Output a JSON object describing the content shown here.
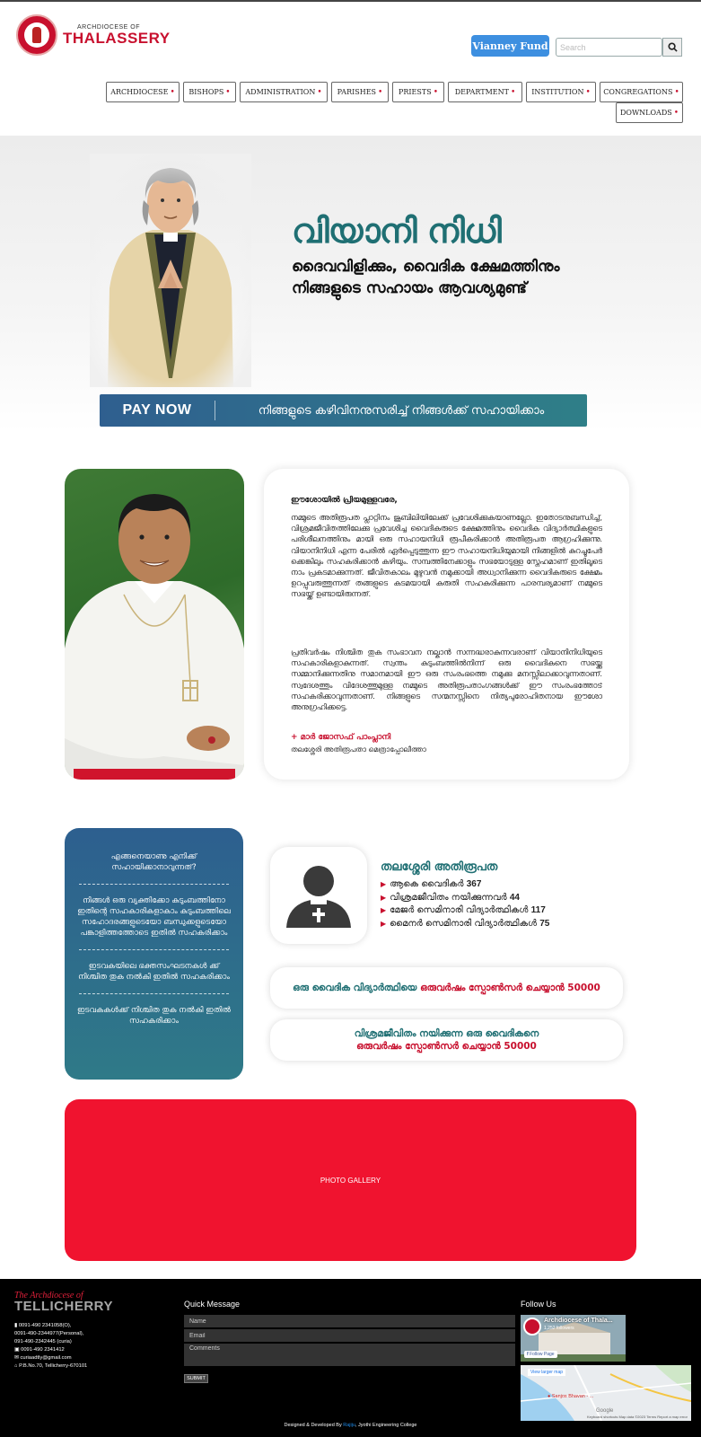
{
  "header": {
    "logo_small": "ARCHDIOCESE OF",
    "logo_big": "THALASSERY",
    "vianney_label": "Vianney Fund",
    "search_placeholder": "Search",
    "nav": [
      "ARCHDIOCESE",
      "BISHOPS",
      "ADMINISTRATION",
      "PARISHES",
      "PRIESTS",
      "DEPARTMENT",
      "INSTITUTION",
      "CONGREGATIONS",
      "DOWNLOADS"
    ]
  },
  "banner": {
    "title": "വിയാനി നിധി",
    "subtitle_line1": "ദൈവവിളിക്കും, വൈദിക ക്ഷേമത്തിനും",
    "subtitle_line2": "നിങ്ങളുടെ സഹായം ആവശ്യമുണ്ട്",
    "pay_now": "PAY NOW",
    "pay_text": "നിങ്ങളുടെ കഴിവിനനുസരിച്ച് നിങ്ങൾക്ക് സഹായിക്കാം"
  },
  "letter": {
    "salutation": "ഈശോയിൽ പ്രിയമുള്ളവരേ,",
    "para1": "നമ്മുടെ അതിരൂപത പ്ലാറ്റിനം ജൂബിലിയിലേക്ക് പ്രവേശിക്കുകയാണല്ലോ. ഇതോടനുബന്ധിച്ച്, വിശ്രമജീവിതത്തിലേക്കു പ്രവേശിച്ച വൈദികരുടെ ക്ഷേമത്തിനും വൈദിക വിദ്യാർത്ഥികളുടെ പരിശീലനത്തിനും മായി ഒരു സഹായനിധി രൂപീകരിക്കാൻ അതിരൂപത ആഗ്രഹിക്കുന്നു. വിയാനിനിധി എന്ന പേരിൽ ഏർപ്പെടുത്തുന്ന ഈ സഹായനിധിയുമായി നിങ്ങളിൽ കുറച്ചുപേർ ക്കെങ്കിലും സഹകരിക്കാൻ കഴിയും. സമ്പത്തിനേക്കാളും സഭയോടുള്ള സ്നേഹമാണ് ഇതിലൂടെ നാം പ്രകടമാക്കുന്നത്. ജീവിതകാലം മുഴുവൻ നമുക്കായി അധ്വാനിക്കുന്ന വൈദികരുടെ ക്ഷേമം ഉറപ്പുവരുത്തുന്നത് തങ്ങളുടെ കടമയായി കരുതി സഹകരിക്കുന്ന പാരമ്പര്യമാണ് നമ്മുടെ സഭയ്ക്ക് ഉണ്ടായിരുന്നത്.",
    "para2": "പ്രതിവർഷം നിശ്ചിത തുക സംഭാവന നല്കാൻ സന്നദ്ധരാകുന്നവരാണ് വിയാനിനിധിയുടെ സഹകാരികളാകുന്നത്. സ്വന്തം കുടുംബത്തിൽനിന്ന് ഒരു വൈദികനെ സഭയ്ക്കു സമ്മാനിക്കുന്നതിനു സമാനമായി ഈ ഒരു സംരംഭത്തെ നമുക്കു മനസ്സിലാക്കാവുന്നതാണ്. സ്വദേശത്തും വിദേശത്തുമുള്ള നമ്മുടെ അതിരൂപതാംഗങ്ങൾക്ക് ഈ സംരംഭത്തോട് സഹകരിക്കാവുന്നതാണ്. നിങ്ങളുടെ സന്മനസ്സിനെ നിത്യപുരോഹിതനായ ഈശോ അനുഗ്രഹിക്കട്ടെ.",
    "signature": "+ മാർ ജോസഫ് പാംപ്ലാനി",
    "role": "തലശ്ശേരി അതിരൂപതാ മെത്രാപ്പോലീത്താ"
  },
  "help": {
    "items": [
      "എങ്ങനെയാണു എനിക്ക് സഹായിക്കാനാവുന്നത്?",
      "നിങ്ങൾ ഒരു വ്യക്തിക്കോ കുടുംബത്തിനോ ഇതിന്റെ സഹകാരികളാകാം കുടുംബത്തിലെ സഹോദരങ്ങളുടെയോ ബന്ധുക്കളുടെയോ പങ്കാളിത്തത്തോടെ ഇതിൽ സഹകരിക്കാം",
      "ഇടവകയിലെ ഭക്തസംഘടനകൾ ക്ക് നിശ്ചിത തുക നൽകി ഇതിൽ സഹകരിക്കാം",
      "ഇടവകകൾക്ക് നിശ്ചിത തുക നൽകി ഇതിൽ സഹകരിക്കാം"
    ]
  },
  "stats": {
    "title": "തലശ്ശേരി അതിരൂപത",
    "rows": [
      {
        "label": "ആകെ വൈദികർ",
        "value": "367"
      },
      {
        "label": "വിശ്രമജീവിതം നയിക്കുന്നവർ",
        "value": "44"
      },
      {
        "label": "മേജർ സെമിനാരി വിദ്യാർത്ഥികൾ",
        "value": "117"
      },
      {
        "label": "മൈനർ സെമിനാരി വിദ്യാർത്ഥികൾ",
        "value": "75"
      }
    ]
  },
  "sponsor": {
    "one_a": "ഒരു വൈദിക വിദ്യാർത്ഥിയെ ",
    "one_b": "ഒരുവർഷം സ്പോൺസർ ചെയ്യാൻ 50000",
    "two_a": "വിശ്രമജീവിതം നയിക്കുന്ന ഒരു വൈദികനെ",
    "two_b": "ഒരുവർഷം സ്പോൺസർ ചെയ്യാൻ 50000"
  },
  "gallery": {
    "label": "PHOTO GALLERY"
  },
  "footer": {
    "logo_top": "The Archdiocese of",
    "logo_big": "TELLICHERRY",
    "contact": [
      "0091-490 2341058(O),",
      "0091-490-2344977(Personal),",
      "091-490-2342445 (curia)",
      "0091-490 2341412",
      "curiaadtly@gmail.com",
      "P.B.No.70, Tellicherry-670101"
    ],
    "quick_message": "Quick Message",
    "name_placeholder": "Name",
    "email_placeholder": "Email",
    "comments_placeholder": "Comments",
    "submit": "SUBMIT",
    "follow_us": "Follow Us",
    "fb_title": "Archdiocese of Thala...",
    "fb_likes": "1,252 followers",
    "fb_follow": "Follow Page",
    "map_link": "View larger map",
    "map_place": "Sanjos Bhavan - ...",
    "map_google": "Google",
    "map_credit": "Keyboard shortcuts   Map data ©2023   Terms   Report a map error",
    "credit_prefix": "Designed & Developed By ",
    "credit_link": "Rajiju",
    "credit_suffix": ", Jyothi Engineering College"
  },
  "colors": {
    "brand_red": "#c8102e",
    "teal": "#1f6f73",
    "blue_button": "#3d8fe0",
    "gallery_red": "#f0132f"
  }
}
